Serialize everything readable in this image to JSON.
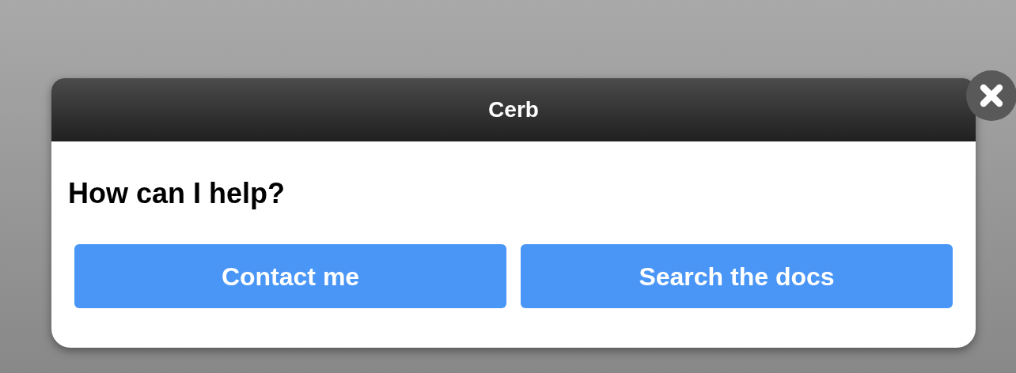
{
  "dialog": {
    "title": "Cerb",
    "heading": "How can I help?",
    "buttons": [
      {
        "label": "Contact me"
      },
      {
        "label": "Search the docs"
      }
    ]
  }
}
